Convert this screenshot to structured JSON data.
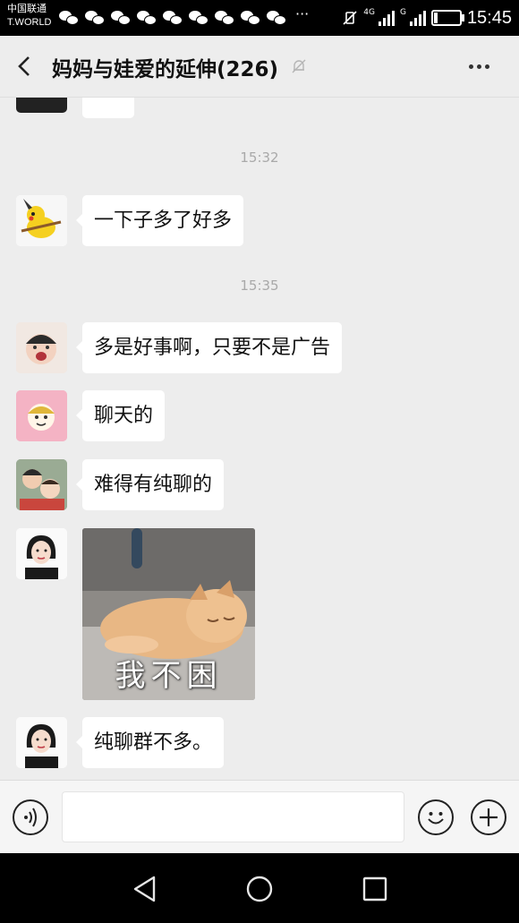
{
  "status_bar": {
    "carrier_line1": "中国联通",
    "carrier_line2": "T.WORLD",
    "notification_count": 9,
    "overflow": "···",
    "network_1": "4G",
    "network_2": "G",
    "battery_level": 0.12,
    "time": "15:45"
  },
  "header": {
    "title": "妈妈与娃爱的延伸(226)",
    "mute_icon": "bell-off-icon",
    "more_icon": "more-icon"
  },
  "messages": {
    "time1": "15:32",
    "msg1": "一下子多了好多",
    "time2": "15:35",
    "msg2": "多是好事啊，只要不是广告",
    "msg3": "聊天的",
    "msg4": "难得有纯聊的",
    "sticker_text": "我不困",
    "msg5": "纯聊群不多。"
  },
  "input_bar": {
    "voice_icon": "voice-icon",
    "input_value": "",
    "emoji_icon": "emoji-icon",
    "plus_icon": "plus-icon"
  },
  "colors": {
    "chat_bg": "#ededed",
    "bubble": "#ffffff",
    "time_text": "#a9a9a9",
    "status_bar": "#000000"
  }
}
